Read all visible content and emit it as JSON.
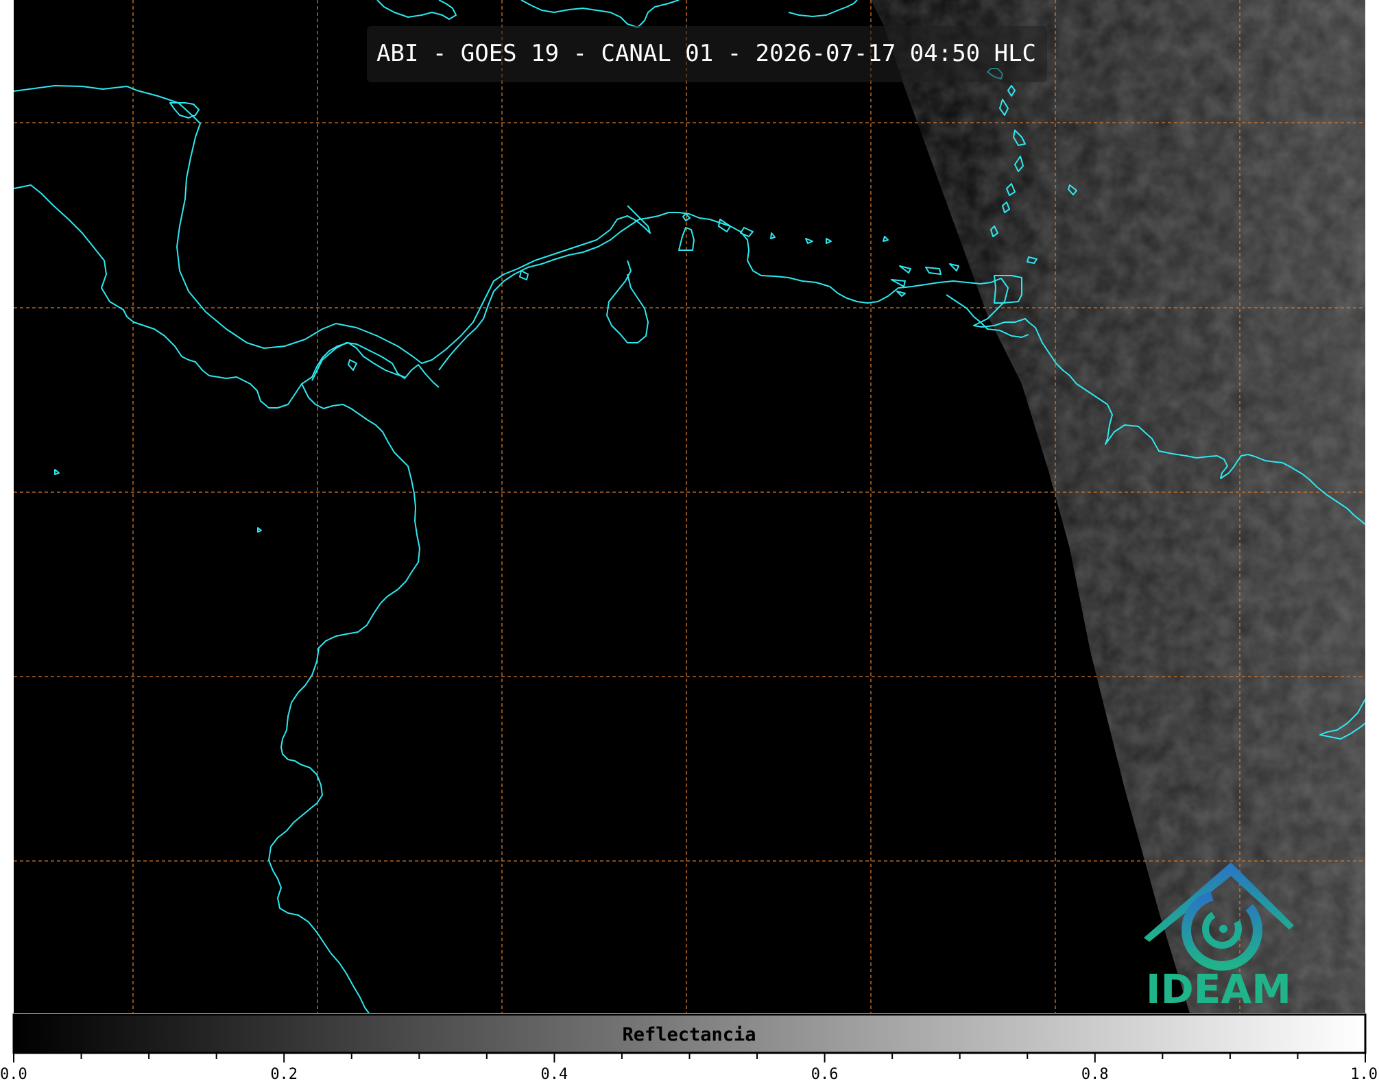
{
  "title": "ABI - GOES 19 - CANAL 01 - 2026-07-17 04:50 HLC",
  "colorbar": {
    "label": "Reflectancia",
    "range": [
      0.0,
      1.0
    ],
    "major_ticks": [
      "0.0",
      "0.2",
      "0.4",
      "0.6",
      "0.8",
      "1.0"
    ],
    "gradient": [
      "#000000",
      "#ffffff"
    ]
  },
  "logo": {
    "name": "IDEAM",
    "colors": {
      "blue": "#2a7bbf",
      "teal": "#1fb48a"
    }
  },
  "colors": {
    "coastline": "#2ee8f0",
    "gridlines": "#d4782c",
    "background": "#000000"
  }
}
